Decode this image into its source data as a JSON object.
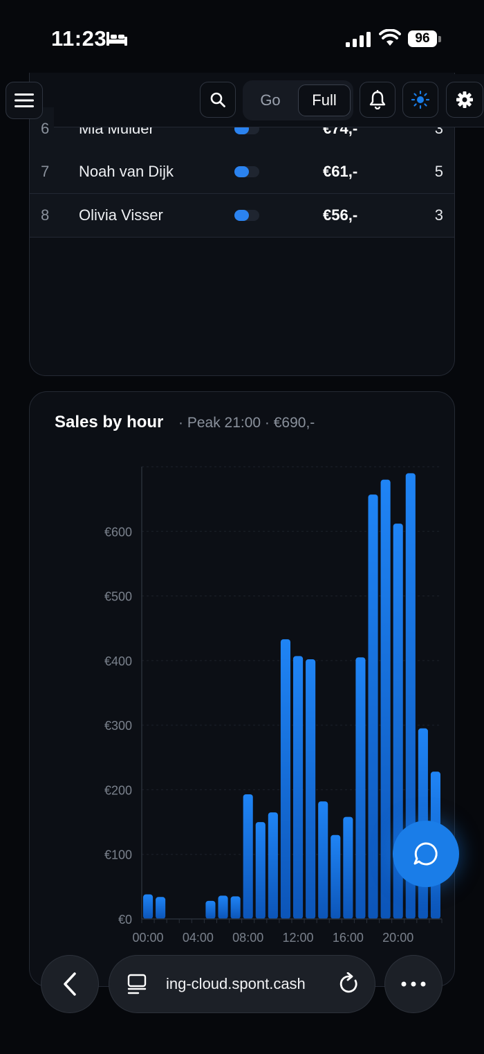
{
  "status_bar": {
    "time": "11:23",
    "battery": "96"
  },
  "toolbar": {
    "seg_go": "Go",
    "seg_full": "Full"
  },
  "table": {
    "rows": [
      {
        "rank": "6",
        "name": "Mia Mulder",
        "amount": "€74,-",
        "count": "3"
      },
      {
        "rank": "7",
        "name": "Noah van Dijk",
        "amount": "€61,-",
        "count": "5"
      },
      {
        "rank": "8",
        "name": "Olivia Visser",
        "amount": "€56,-",
        "count": "3"
      }
    ]
  },
  "chart_card": {
    "title": "Sales by hour",
    "subtitle": "· Peak 21:00 · €690,-"
  },
  "chart_data": {
    "type": "bar",
    "title": "Sales by hour",
    "categories": [
      "00:00",
      "01:00",
      "02:00",
      "03:00",
      "04:00",
      "05:00",
      "06:00",
      "07:00",
      "08:00",
      "09:00",
      "10:00",
      "11:00",
      "12:00",
      "13:00",
      "14:00",
      "15:00",
      "16:00",
      "17:00",
      "18:00",
      "19:00",
      "20:00",
      "21:00",
      "22:00",
      "23:00"
    ],
    "x_tick_labels": [
      "00:00",
      "04:00",
      "08:00",
      "12:00",
      "16:00",
      "20:00"
    ],
    "y_tick_labels": [
      "€0",
      "€100",
      "€200",
      "€300",
      "€400",
      "€500",
      "€600"
    ],
    "series": [
      {
        "values": [
          38,
          34,
          0,
          0,
          0,
          28,
          36,
          35,
          193,
          150,
          165,
          433,
          407,
          402,
          182,
          130,
          158,
          405,
          657,
          680,
          612,
          690,
          295,
          228
        ]
      }
    ],
    "ylim": [
      0,
      700
    ],
    "grid": true,
    "bar_color": "#1a7de8"
  },
  "bottom_bar": {
    "url": "ing-cloud.spont.cash"
  },
  "colors": {
    "accent": "#1a7de8",
    "background": "#06080c",
    "card": "#0c0f15"
  }
}
